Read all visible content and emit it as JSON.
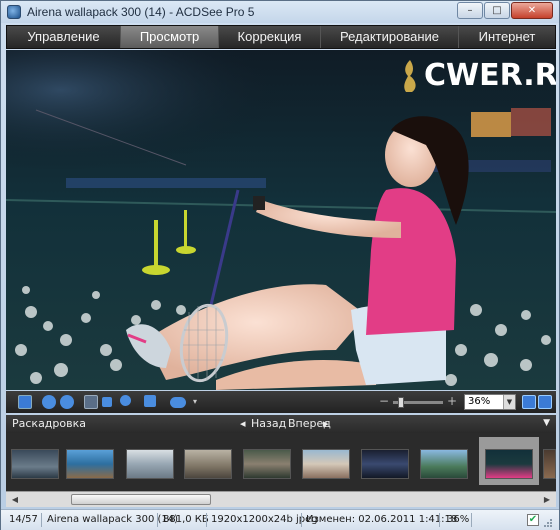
{
  "window": {
    "title": "Airena wallapack 300 (14) - ACDSee Pro 5",
    "minimize_glyph": "–",
    "maximize_glyph": "□",
    "close_glyph": "✕"
  },
  "mode_tabs": [
    {
      "label": "Управление",
      "active": false
    },
    {
      "label": "Просмотр",
      "active": true
    },
    {
      "label": "Коррекция",
      "active": false
    },
    {
      "label": "Редактирование",
      "active": false
    },
    {
      "label": "Интернет",
      "active": false
    }
  ],
  "watermark": "CWER.RU",
  "viewer_toolbar": {
    "icons": [
      "save-icon",
      "rotate-left-icon",
      "rotate-right-icon",
      "hand-tool-icon",
      "select-tool-icon",
      "zoom-tool-icon",
      "fit-icon",
      "eye-icon"
    ],
    "zoom_minus": "−",
    "zoom_plus": "+",
    "zoom_value": "36%",
    "zoom_level": 0.36
  },
  "filmstrip": {
    "label": "Раскадровка",
    "back": "Назад",
    "forward": "Вперед",
    "thumbnail_count": 11,
    "selected_index": 9
  },
  "statusbar": {
    "position": "14/57",
    "filename": "Airena wallapack 300 (14)",
    "filesize": "881,0 КБ",
    "dimensions": "1920x1200x24b jpeg",
    "modified": "Изменен: 02.06.2011 1:41:18",
    "zoom": "36%"
  },
  "colors": {
    "accent": "#e23d86",
    "tab_bg": "#2f2f2f",
    "tab_active": "#7a7a7a"
  }
}
